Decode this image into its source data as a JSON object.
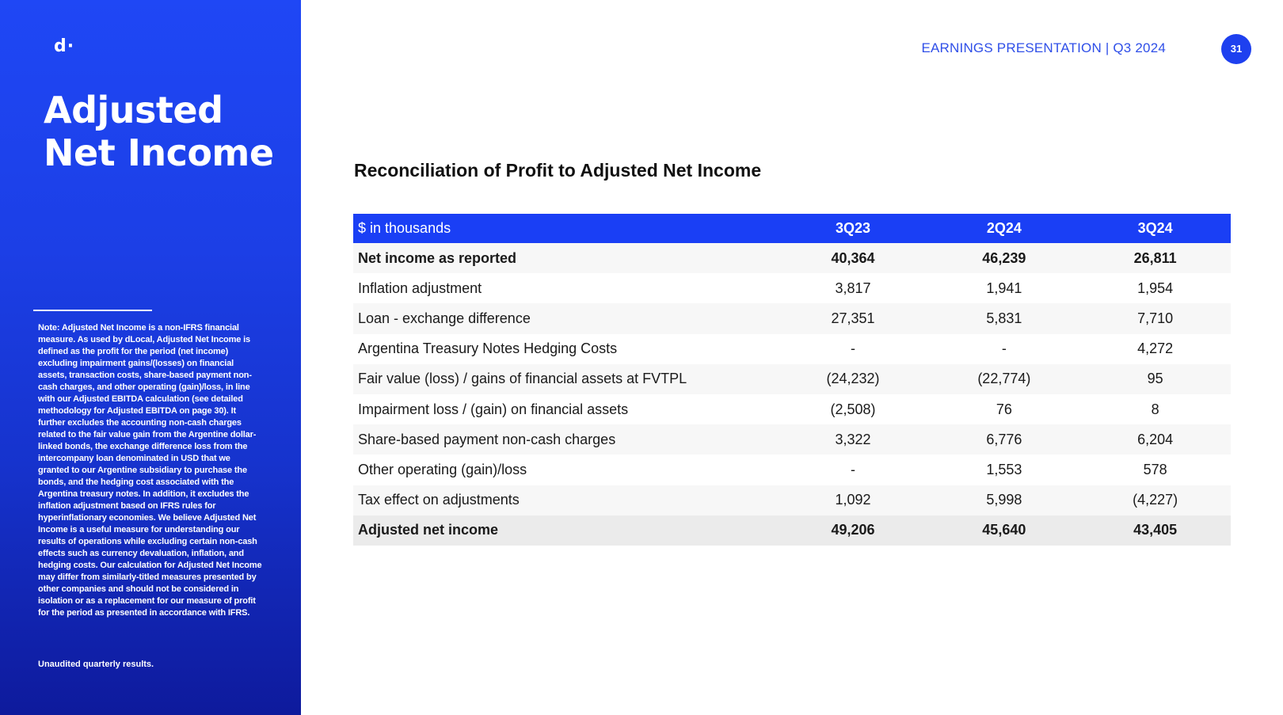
{
  "sidebar": {
    "logo_text": "d·",
    "title_line1": "Adjusted",
    "title_line2": "Net Income",
    "note": "Note: Adjusted Net Income is a non-IFRS financial measure. As used by dLocal, Adjusted Net Income is defined as the profit for the period (net income) excluding impairment gains/(losses) on financial assets, transaction costs, share-based payment non-cash charges, and other operating (gain)/loss, in line with our Adjusted EBITDA calculation (see detailed methodology for Adjusted EBITDA on page 30). It further excludes the accounting non-cash charges related to the fair value gain from the Argentine dollar-linked bonds, the exchange difference loss from the intercompany loan denominated in USD that we granted to our Argentine subsidiary to purchase the bonds, and the hedging cost associated with the Argentina treasury notes. In addition, it excludes the inflation adjustment based on IFRS rules for hyperinflationary economies. We believe Adjusted Net Income is a useful measure for understanding our results of operations while excluding certain non-cash effects such as currency devaluation, inflation, and hedging costs. Our calculation for Adjusted Net Income may differ from similarly-titled measures presented by other companies and should not be considered in isolation or as a replacement for our measure of profit for the period as presented in accordance with IFRS.",
    "unaudited": "Unaudited quarterly results."
  },
  "header": {
    "label": "EARNINGS PRESENTATION | Q3 2024",
    "page_number": "31"
  },
  "main": {
    "title": "Reconciliation of Profit to Adjusted Net Income"
  },
  "table": {
    "columns": [
      "$ in thousands",
      "3Q23",
      "2Q24",
      "3Q24"
    ],
    "rows": [
      {
        "label": "Net income as reported",
        "values": [
          "40,364",
          "46,239",
          "26,811"
        ]
      },
      {
        "label": "Inflation adjustment",
        "values": [
          "3,817",
          "1,941",
          "1,954"
        ]
      },
      {
        "label": "Loan - exchange difference",
        "values": [
          "27,351",
          "5,831",
          "7,710"
        ]
      },
      {
        "label": "Argentina Treasury Notes Hedging Costs",
        "values": [
          "-",
          "-",
          "4,272"
        ]
      },
      {
        "label": "Fair value (loss) / gains of financial assets at FVTPL",
        "values": [
          "(24,232)",
          "(22,774)",
          "95"
        ]
      },
      {
        "label": "Impairment loss / (gain) on financial assets",
        "values": [
          "(2,508)",
          "76",
          "8"
        ]
      },
      {
        "label": "Share-based payment non-cash charges",
        "values": [
          "3,322",
          "6,776",
          "6,204"
        ]
      },
      {
        "label": "Other operating (gain)/loss",
        "values": [
          "-",
          "1,553",
          "578"
        ]
      },
      {
        "label": "Tax effect on adjustments",
        "values": [
          "1,092",
          "5,998",
          "(4,227)"
        ]
      },
      {
        "label": "Adjusted net income",
        "values": [
          "49,206",
          "45,640",
          "43,405"
        ]
      }
    ]
  },
  "colors": {
    "brand_blue": "#1a3ff5",
    "header_text": "#2f4fe8"
  }
}
